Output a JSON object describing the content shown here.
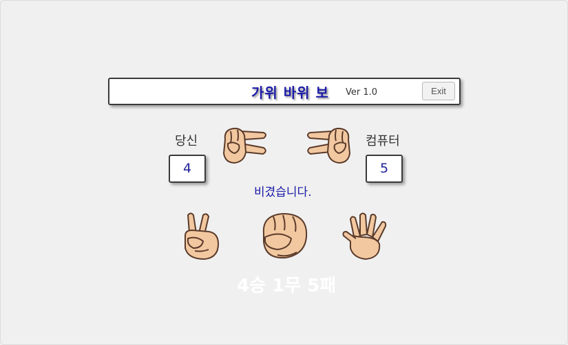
{
  "header": {
    "title": "가위 바위 보",
    "version": "Ver 1.0",
    "exit_label": "Exit"
  },
  "player": {
    "label": "당신",
    "score": "4",
    "shown_hand": "scissors"
  },
  "computer": {
    "label": "컴퓨터",
    "score": "5",
    "shown_hand": "scissors"
  },
  "result_text": "비겼습니다.",
  "choices": [
    {
      "name": "scissors-icon"
    },
    {
      "name": "rock-icon"
    },
    {
      "name": "paper-icon"
    }
  ],
  "tally": "4승 1무 5패",
  "colors": {
    "accent": "#1a1aa8",
    "skin": "#f2c8a0",
    "outline": "#5a3a2a"
  }
}
